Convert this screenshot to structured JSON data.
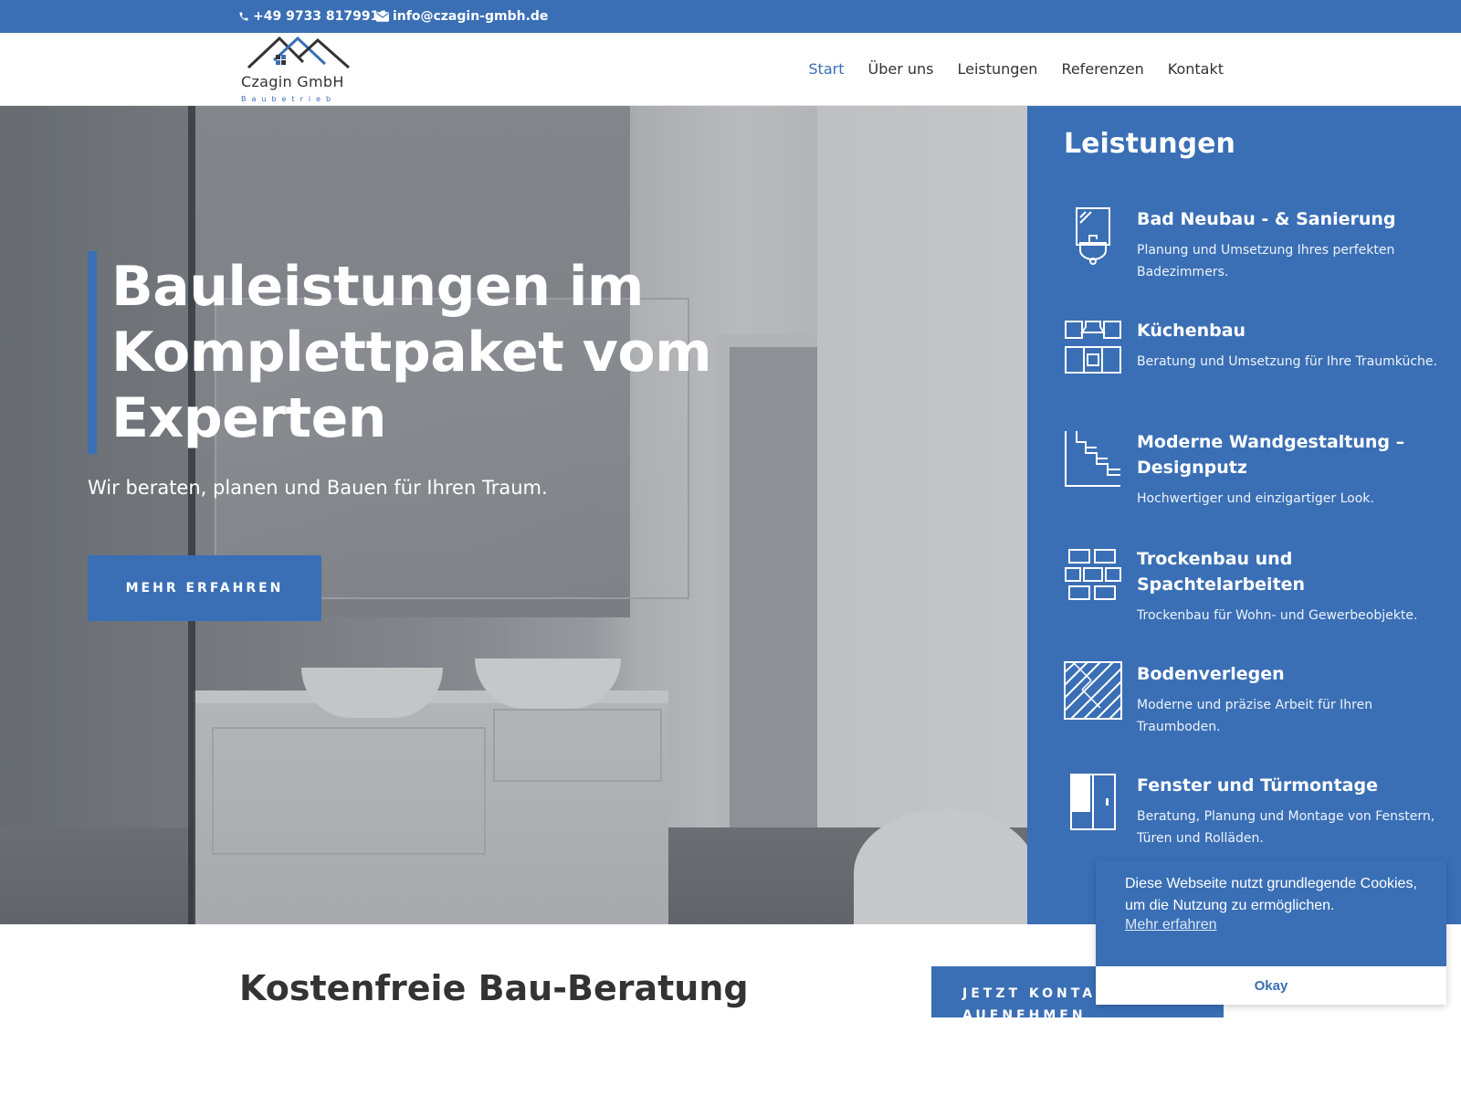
{
  "topbar": {
    "phone": "+49 9733 8179911",
    "email": "info@czagin-gmbh.de"
  },
  "logo": {
    "name": "Czagin GmbH",
    "tagline": "Baubetrieb"
  },
  "nav": {
    "items": [
      {
        "label": "Start",
        "active": true
      },
      {
        "label": "Über uns"
      },
      {
        "label": "Leistungen"
      },
      {
        "label": "Referenzen"
      },
      {
        "label": "Kontakt"
      }
    ]
  },
  "hero": {
    "title": "Bauleistungen im Komplettpaket vom Experten",
    "subtitle": "Wir beraten, planen und Bauen für Ihren Traum.",
    "button": "MEHR ERFAHREN"
  },
  "services": {
    "heading": "Leistungen",
    "items": [
      {
        "icon": "bathroom-sink-icon",
        "title": "Bad Neubau - & Sanierung",
        "text": "Planung und Umsetzung Ihres perfekten Badezimmers."
      },
      {
        "icon": "kitchen-icon",
        "title": "Küchenbau",
        "text": "Beratung und Umsetzung für Ihre Traumküche."
      },
      {
        "icon": "wall-design-icon",
        "title": "Moderne Wandgestaltung – Designputz",
        "text": "Hochwertiger und einzigartiger Look."
      },
      {
        "icon": "drywall-bricks-icon",
        "title": "Trockenbau und Spachtelarbeiten",
        "text": "Trockenbau für Wohn- und Gewerbeobjekte."
      },
      {
        "icon": "parquet-floor-icon",
        "title": "Bodenverlegen",
        "text": "Moderne und präzise Arbeit für Ihren Traumboden."
      },
      {
        "icon": "window-door-icon",
        "title": "Fenster und Türmontage",
        "text": "Beratung, Planung und Montage von Fenstern, Türen und Rolläden."
      }
    ]
  },
  "bottom": {
    "title": "Kostenfreie Bau-Beratung",
    "button": "JETZT KONTAKT AUFNEHMEN"
  },
  "cookie": {
    "message": "Diese Webseite nutzt grundlegende Cookies, um die Nutzung zu ermöglichen.",
    "link": "Mehr erfahren",
    "button": "Okay"
  },
  "colors": {
    "brand_blue": "#3a6fb5"
  }
}
